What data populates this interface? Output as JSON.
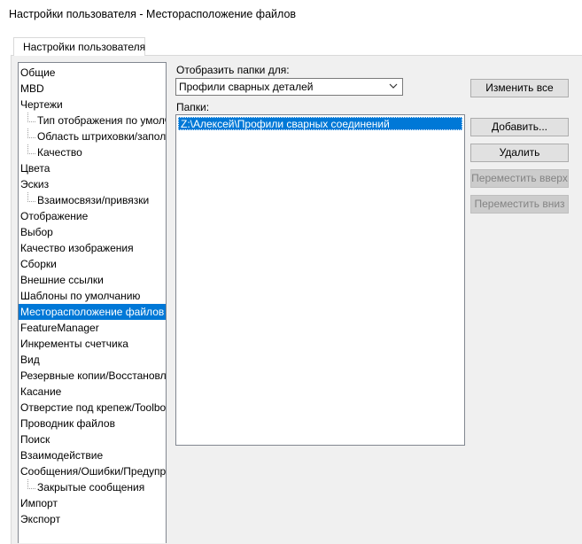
{
  "window": {
    "title": "Настройки пользователя - Месторасположение файлов"
  },
  "tab": {
    "label": "Настройки пользователя"
  },
  "tree": {
    "items": [
      {
        "label": "Общие",
        "child": false,
        "selected": false
      },
      {
        "label": "MBD",
        "child": false,
        "selected": false
      },
      {
        "label": "Чертежи",
        "child": false,
        "selected": false
      },
      {
        "label": "Тип отображения по умолчанию",
        "child": true,
        "selected": false
      },
      {
        "label": "Область штриховки/заполнения",
        "child": true,
        "selected": false
      },
      {
        "label": "Качество",
        "child": true,
        "selected": false
      },
      {
        "label": "Цвета",
        "child": false,
        "selected": false
      },
      {
        "label": "Эскиз",
        "child": false,
        "selected": false
      },
      {
        "label": "Взаимосвязи/привязки",
        "child": true,
        "selected": false
      },
      {
        "label": "Отображение",
        "child": false,
        "selected": false
      },
      {
        "label": "Выбор",
        "child": false,
        "selected": false
      },
      {
        "label": "Качество изображения",
        "child": false,
        "selected": false
      },
      {
        "label": "Сборки",
        "child": false,
        "selected": false
      },
      {
        "label": "Внешние ссылки",
        "child": false,
        "selected": false
      },
      {
        "label": "Шаблоны по умолчанию",
        "child": false,
        "selected": false
      },
      {
        "label": "Месторасположение файлов",
        "child": false,
        "selected": true
      },
      {
        "label": "FeatureManager",
        "child": false,
        "selected": false
      },
      {
        "label": "Инкременты счетчика",
        "child": false,
        "selected": false
      },
      {
        "label": "Вид",
        "child": false,
        "selected": false
      },
      {
        "label": "Резервные копии/Восстановление",
        "child": false,
        "selected": false
      },
      {
        "label": "Касание",
        "child": false,
        "selected": false
      },
      {
        "label": "Отверстие под крепеж/Toolbox",
        "child": false,
        "selected": false
      },
      {
        "label": "Проводник файлов",
        "child": false,
        "selected": false
      },
      {
        "label": "Поиск",
        "child": false,
        "selected": false
      },
      {
        "label": "Взаимодействие",
        "child": false,
        "selected": false
      },
      {
        "label": "Сообщения/Ошибки/Предупреждения",
        "child": false,
        "selected": false
      },
      {
        "label": "Закрытые сообщения",
        "child": true,
        "selected": false
      },
      {
        "label": "Импорт",
        "child": false,
        "selected": false
      },
      {
        "label": "Экспорт",
        "child": false,
        "selected": false
      }
    ]
  },
  "show_folders": {
    "label": "Отобразить папки для:",
    "value": "Профили сварных деталей"
  },
  "folders": {
    "label": "Папки:",
    "items": [
      "Z:\\Алексей\\Профили сварных соединений"
    ]
  },
  "buttons": {
    "edit_all": "Изменить все",
    "add": "Добавить...",
    "delete": "Удалить",
    "move_up": "Переместить вверх",
    "move_down": "Переместить вниз"
  },
  "colors": {
    "selection": "#0078d7",
    "disabled_text": "#838383"
  }
}
